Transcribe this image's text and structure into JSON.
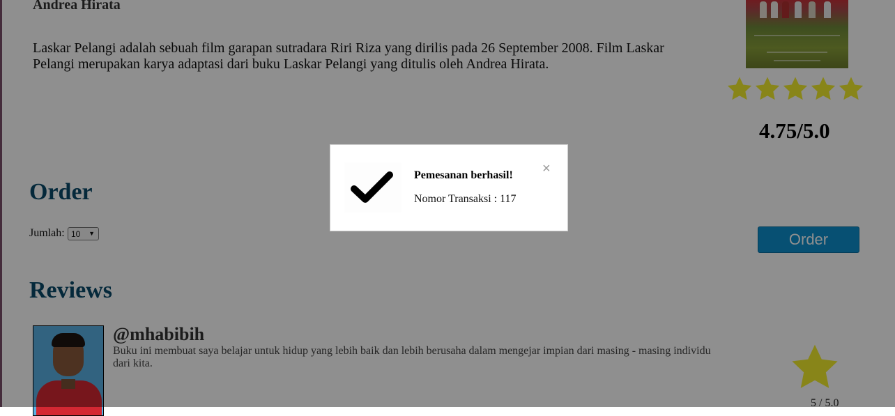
{
  "movie": {
    "author": "Andrea Hirata",
    "synopsis": "Laskar Pelangi adalah sebuah film garapan sutradara Riri Riza yang dirilis pada 26 September 2008. Film Laskar Pelangi merupakan karya adaptasi dari buku Laskar Pelangi yang ditulis oleh Andrea Hirata.",
    "rating_text": "4.75/5.0",
    "rating_value": 4.75,
    "stars_shown": 5,
    "star_color": "#f2ee2d"
  },
  "order": {
    "heading": "Order",
    "qty_label": "Jumlah:",
    "qty_value": "10",
    "button_label": "Order",
    "button_color": "#0d8fcd"
  },
  "reviews": {
    "heading": "Reviews",
    "items": [
      {
        "username": "@mhabibih",
        "text": "Buku ini membuat saya belajar untuk hidup yang lebih baik dan lebih berusaha dalam mengejar impian dari masing - masing individu dari kita.",
        "score": "5 / 5.0"
      }
    ]
  },
  "modal": {
    "title": "Pemesanan berhasil!",
    "transaction": "Nomor Transaksi : 117",
    "close_symbol": "×",
    "icon": "checkmark-icon"
  }
}
